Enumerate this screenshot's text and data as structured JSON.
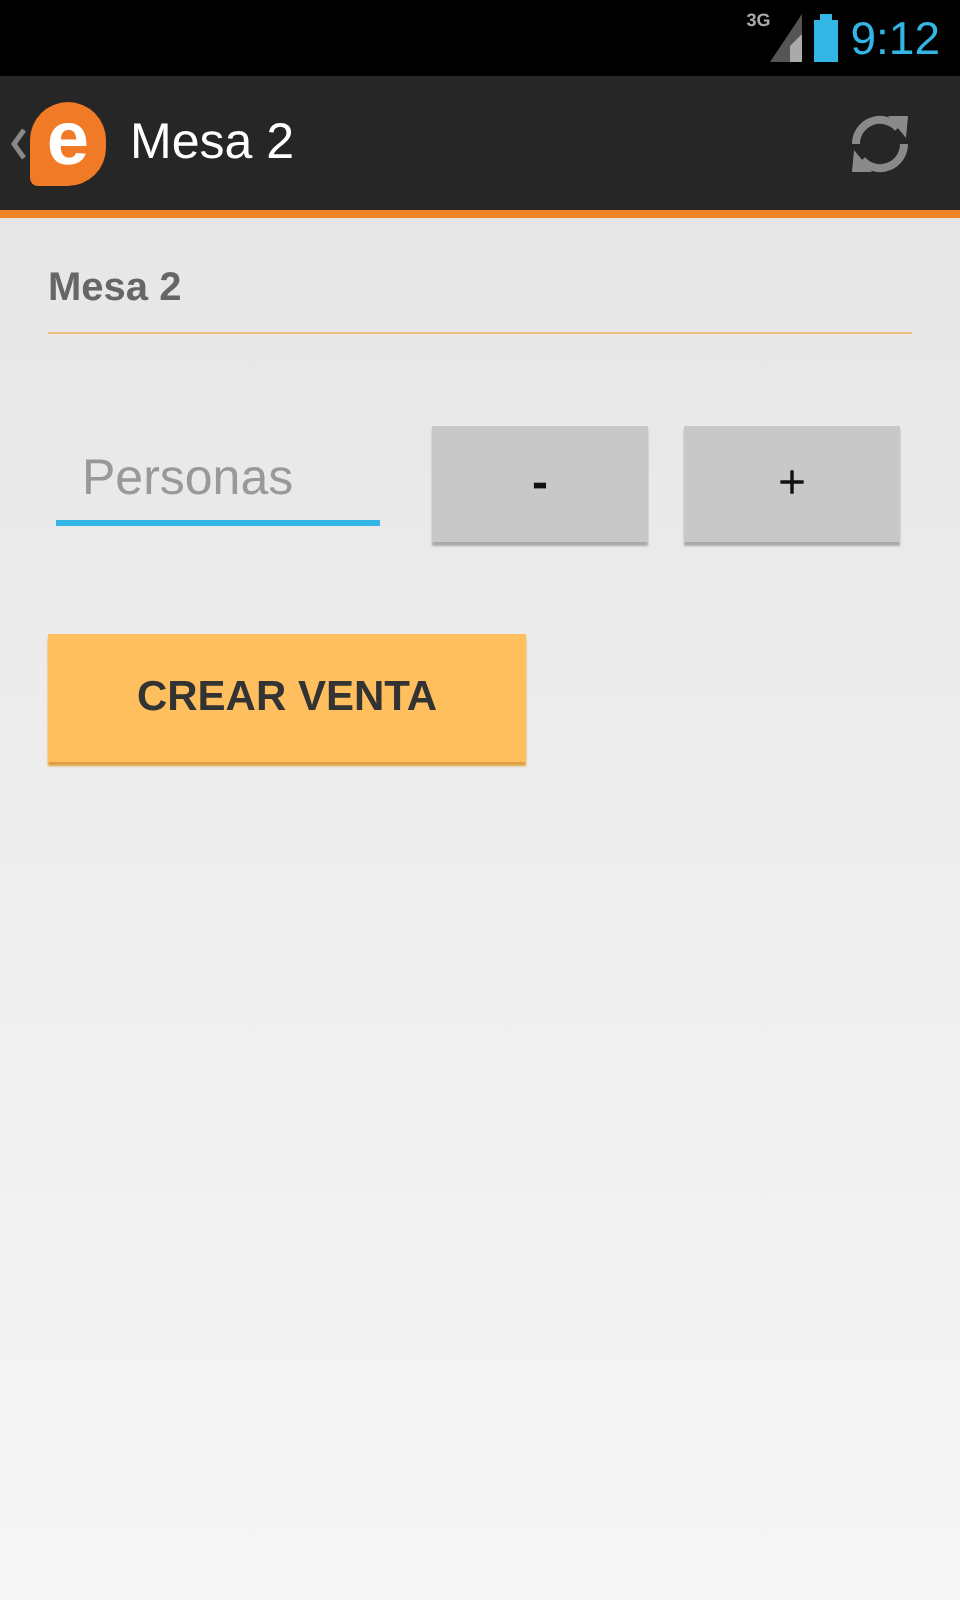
{
  "status_bar": {
    "network": "3G",
    "time": "9:12"
  },
  "action_bar": {
    "logo_letter": "e",
    "title": "Mesa 2"
  },
  "section_title": "Mesa 2",
  "persons_field": {
    "placeholder": "Personas"
  },
  "buttons": [
    {
      "label": "-",
      "kind": "decrement"
    },
    {
      "label": "+",
      "kind": "increment"
    }
  ],
  "primary_button": {
    "label": "CREAR VENTA"
  }
}
